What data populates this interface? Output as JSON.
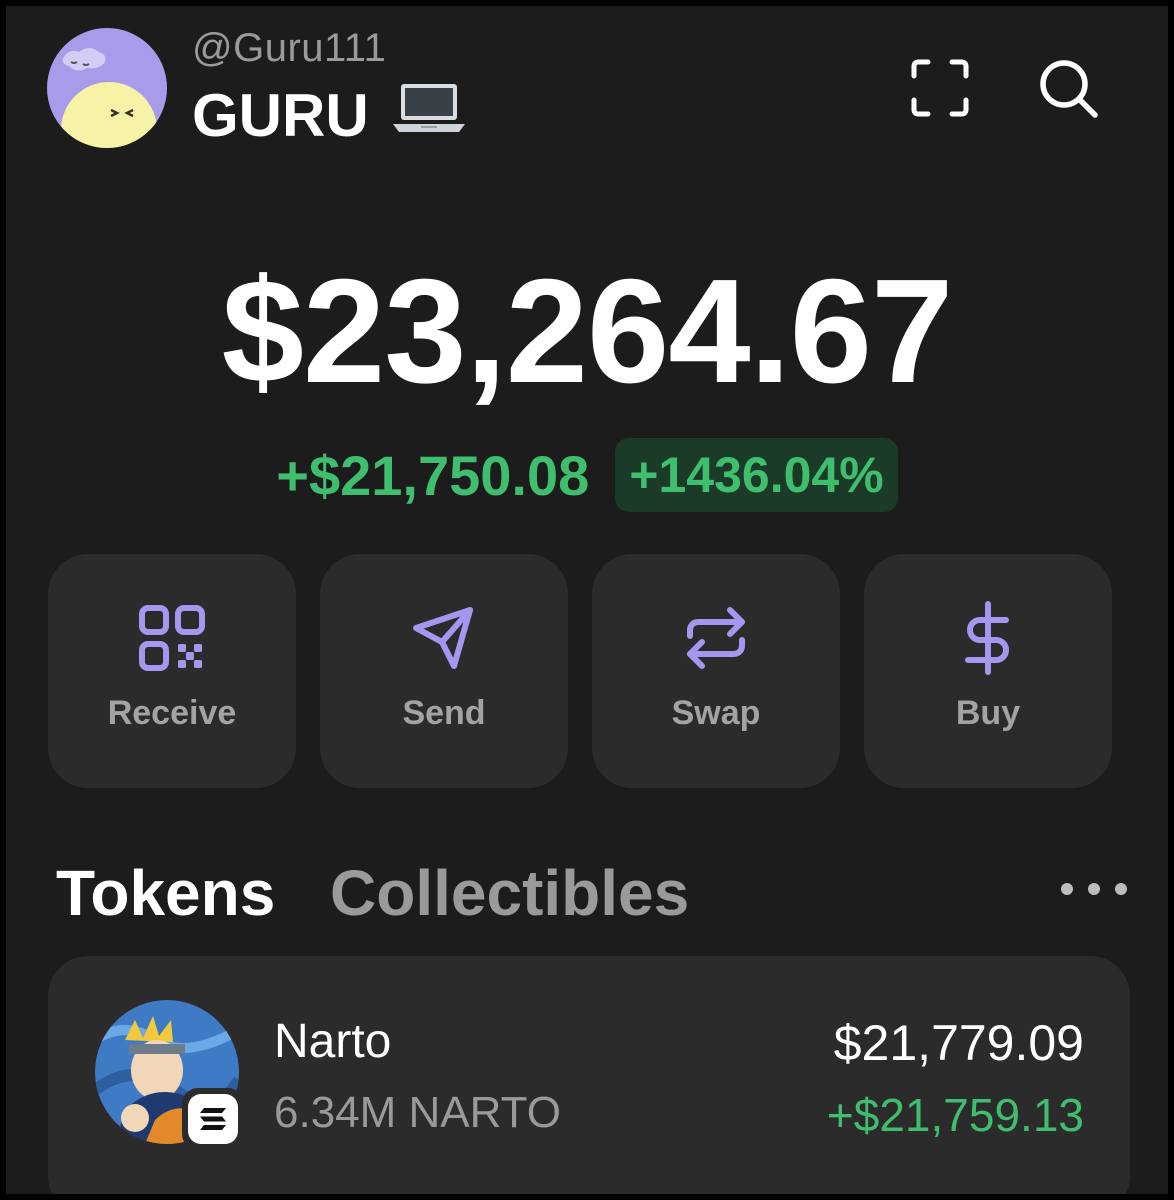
{
  "header": {
    "handle": "@Guru111",
    "account_name": "GURU",
    "account_emoji": "💻",
    "icons": [
      "scan-icon",
      "search-icon"
    ]
  },
  "balance": {
    "total": "$23,264.67",
    "change_abs": "+$21,750.08",
    "change_pct": "+1436.04%"
  },
  "actions": [
    {
      "label": "Receive",
      "icon": "qr-code-icon"
    },
    {
      "label": "Send",
      "icon": "send-icon"
    },
    {
      "label": "Swap",
      "icon": "swap-icon"
    },
    {
      "label": "Buy",
      "icon": "dollar-icon"
    }
  ],
  "tabs": {
    "tokens": "Tokens",
    "collectibles": "Collectibles",
    "active": "Tokens"
  },
  "tokens": [
    {
      "name": "Narto",
      "amount": "6.34M NARTO",
      "value": "$21,779.09",
      "change": "+$21,759.13",
      "chain_icon": "solana-icon"
    }
  ],
  "colors": {
    "background": "#1c1c1c",
    "card": "#2b2b2b",
    "accent": "#a796f0",
    "positive": "#3fbf6e"
  }
}
